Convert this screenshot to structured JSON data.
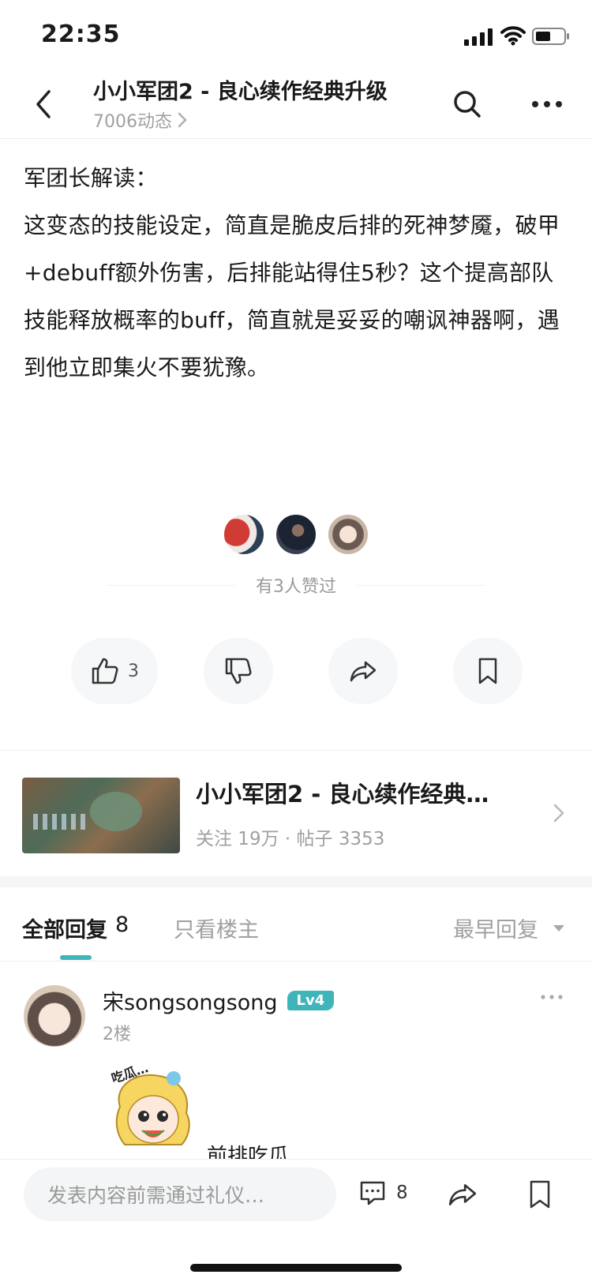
{
  "status_bar": {
    "time": "22:35"
  },
  "header": {
    "title": "小小军团2 - 良心续作经典升级",
    "subtitle": "7006动态"
  },
  "post": {
    "heading": "军团长解读：",
    "body": "这变态的技能设定，简直是脆皮后排的死神梦魇，破甲+debuff额外伤害，后排能站得住5秒？这个提高部队技能释放概率的buff，简直就是妥妥的嘲讽神器啊，遇到他立即集火不要犹豫。"
  },
  "likes": {
    "text": "有3人赞过"
  },
  "actions": {
    "like_count": "3"
  },
  "game_card": {
    "title": "小小军团2 - 良心续作经典…",
    "meta": "关注 19万 · 帖子 3353"
  },
  "replies": {
    "tab_all": "全部回复",
    "tab_all_count": "8",
    "tab_op": "只看楼主",
    "sort": "最早回复",
    "items": [
      {
        "username": "宋songsongsong",
        "level": "Lv4",
        "floor": "2楼",
        "sticker_text": "吃瓜…",
        "text": "前排吃瓜"
      }
    ]
  },
  "bottom_bar": {
    "placeholder": "发表内容前需通过礼仪…",
    "comment_count": "8"
  },
  "colors": {
    "accent": "#3fb5b9",
    "text": "#1a1a1a",
    "muted": "#9a9a9a"
  }
}
